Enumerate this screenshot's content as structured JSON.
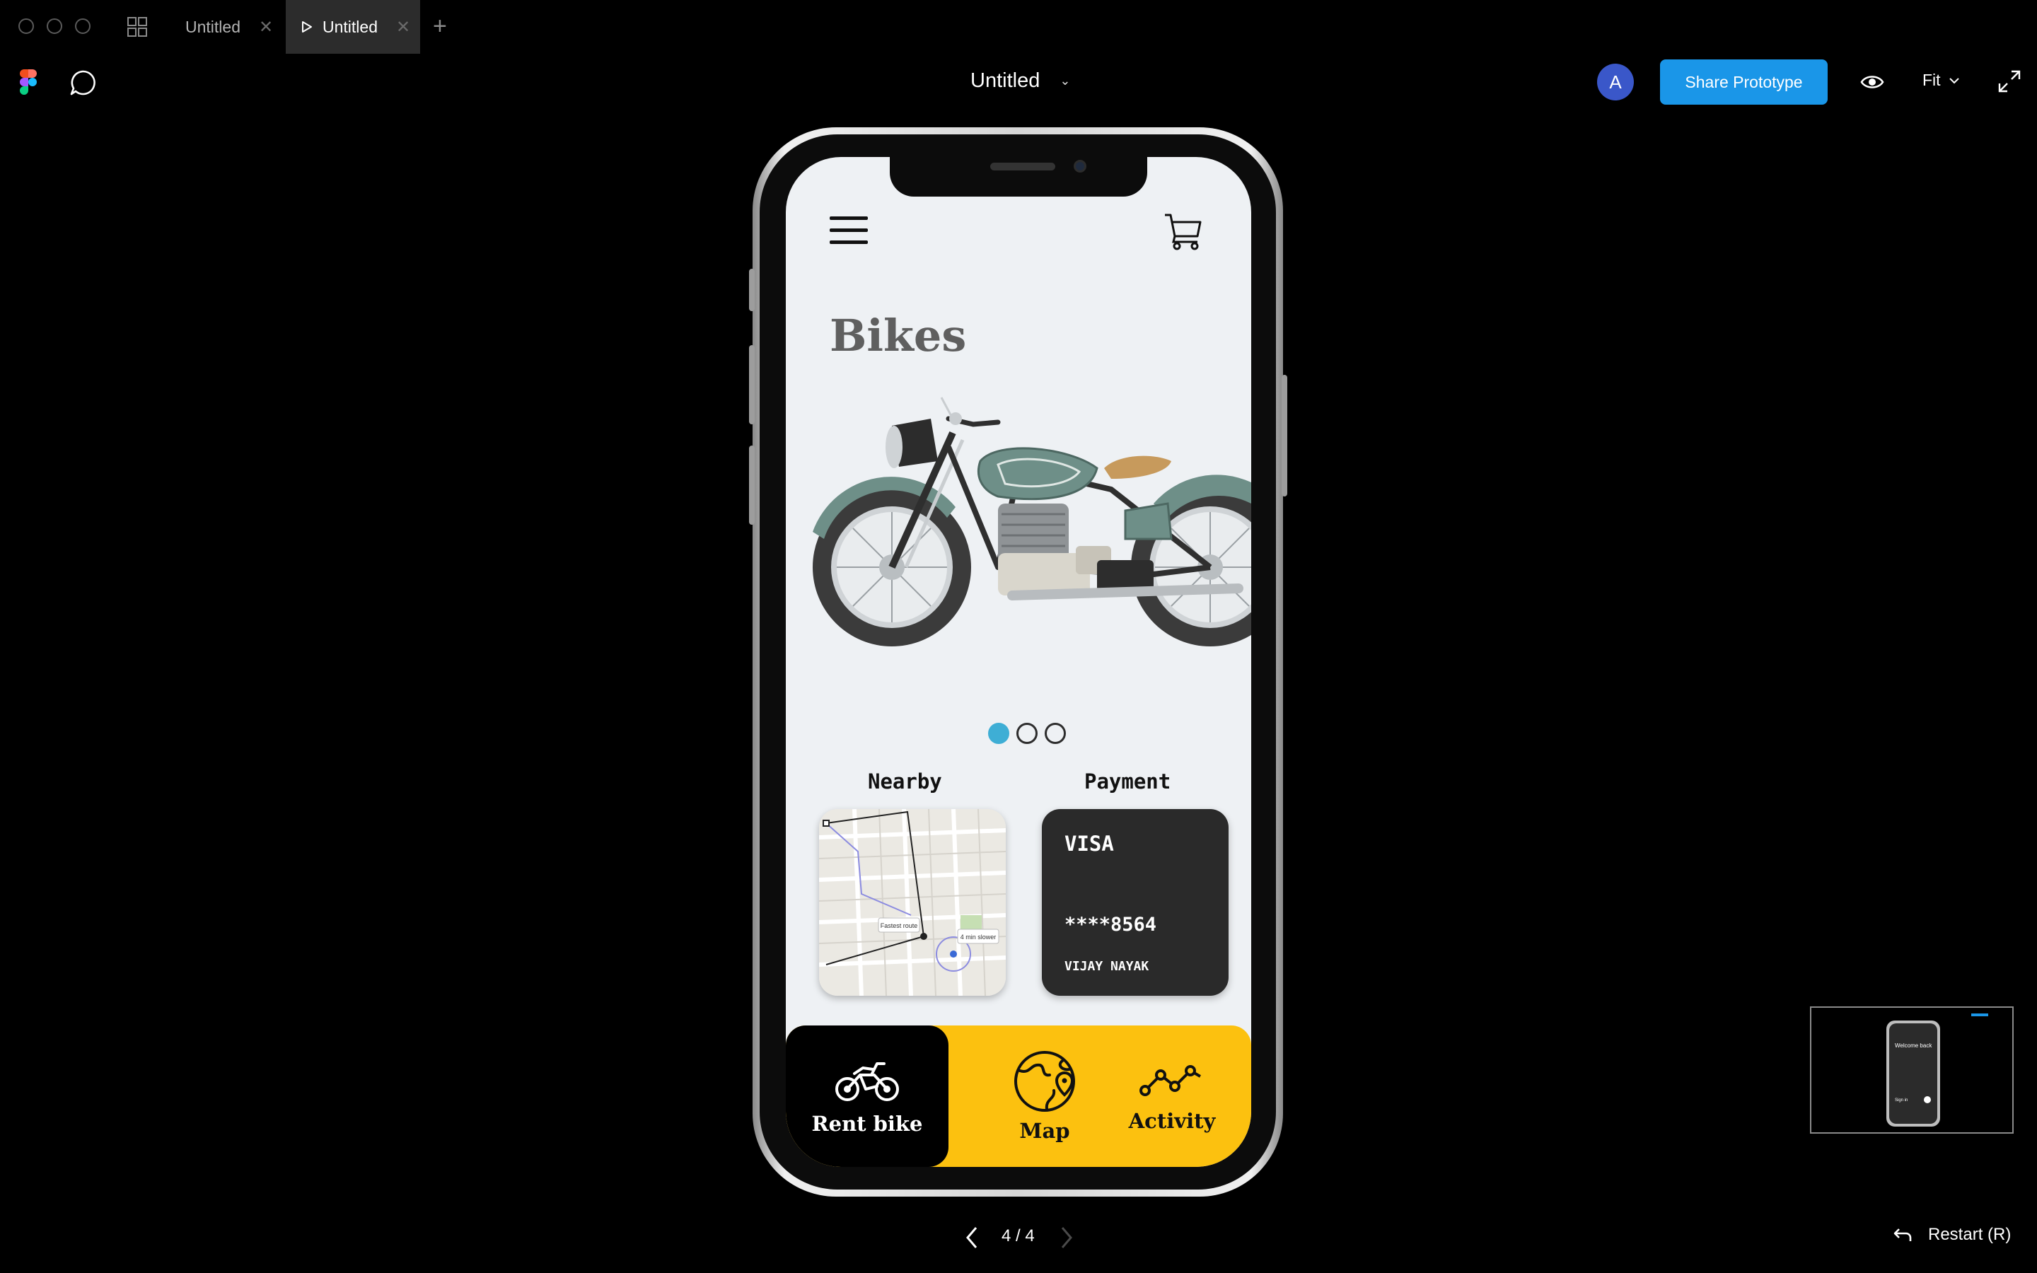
{
  "window": {
    "tabs": [
      {
        "label": "Untitled",
        "active": false
      },
      {
        "label": "Untitled",
        "active": true
      }
    ],
    "tab_close_glyph": "✕",
    "new_tab_glyph": "+"
  },
  "toolbar": {
    "doc_title": "Untitled",
    "avatar_initial": "A",
    "share_label": "Share Prototype",
    "zoom_label": "Fit"
  },
  "prototype": {
    "screen_title": "Bikes",
    "carousel": {
      "count": 3,
      "active_index": 0
    },
    "nearby": {
      "label": "Nearby",
      "map_tags": [
        "Fastest route",
        "4 min slower"
      ]
    },
    "payment": {
      "label": "Payment",
      "brand": "VISA",
      "card_number": "****8564",
      "holder": "VIJAY NAYAK"
    },
    "nav": [
      {
        "label": "Rent bike",
        "icon": "motorbike-icon",
        "active": true
      },
      {
        "label": "Map",
        "icon": "globe-pin-icon",
        "active": false
      },
      {
        "label": "Activity",
        "icon": "activity-graph-icon",
        "active": false
      }
    ],
    "colors": {
      "accent_yellow": "#fcc10f",
      "carousel_active": "#3eaed5",
      "share_button": "#1a96e8",
      "avatar": "#3a57c9"
    }
  },
  "footer": {
    "pager": "4 / 4",
    "restart_label": "Restart (R)"
  },
  "minimap": {
    "title": "Welcome back",
    "action": "Sign in"
  }
}
